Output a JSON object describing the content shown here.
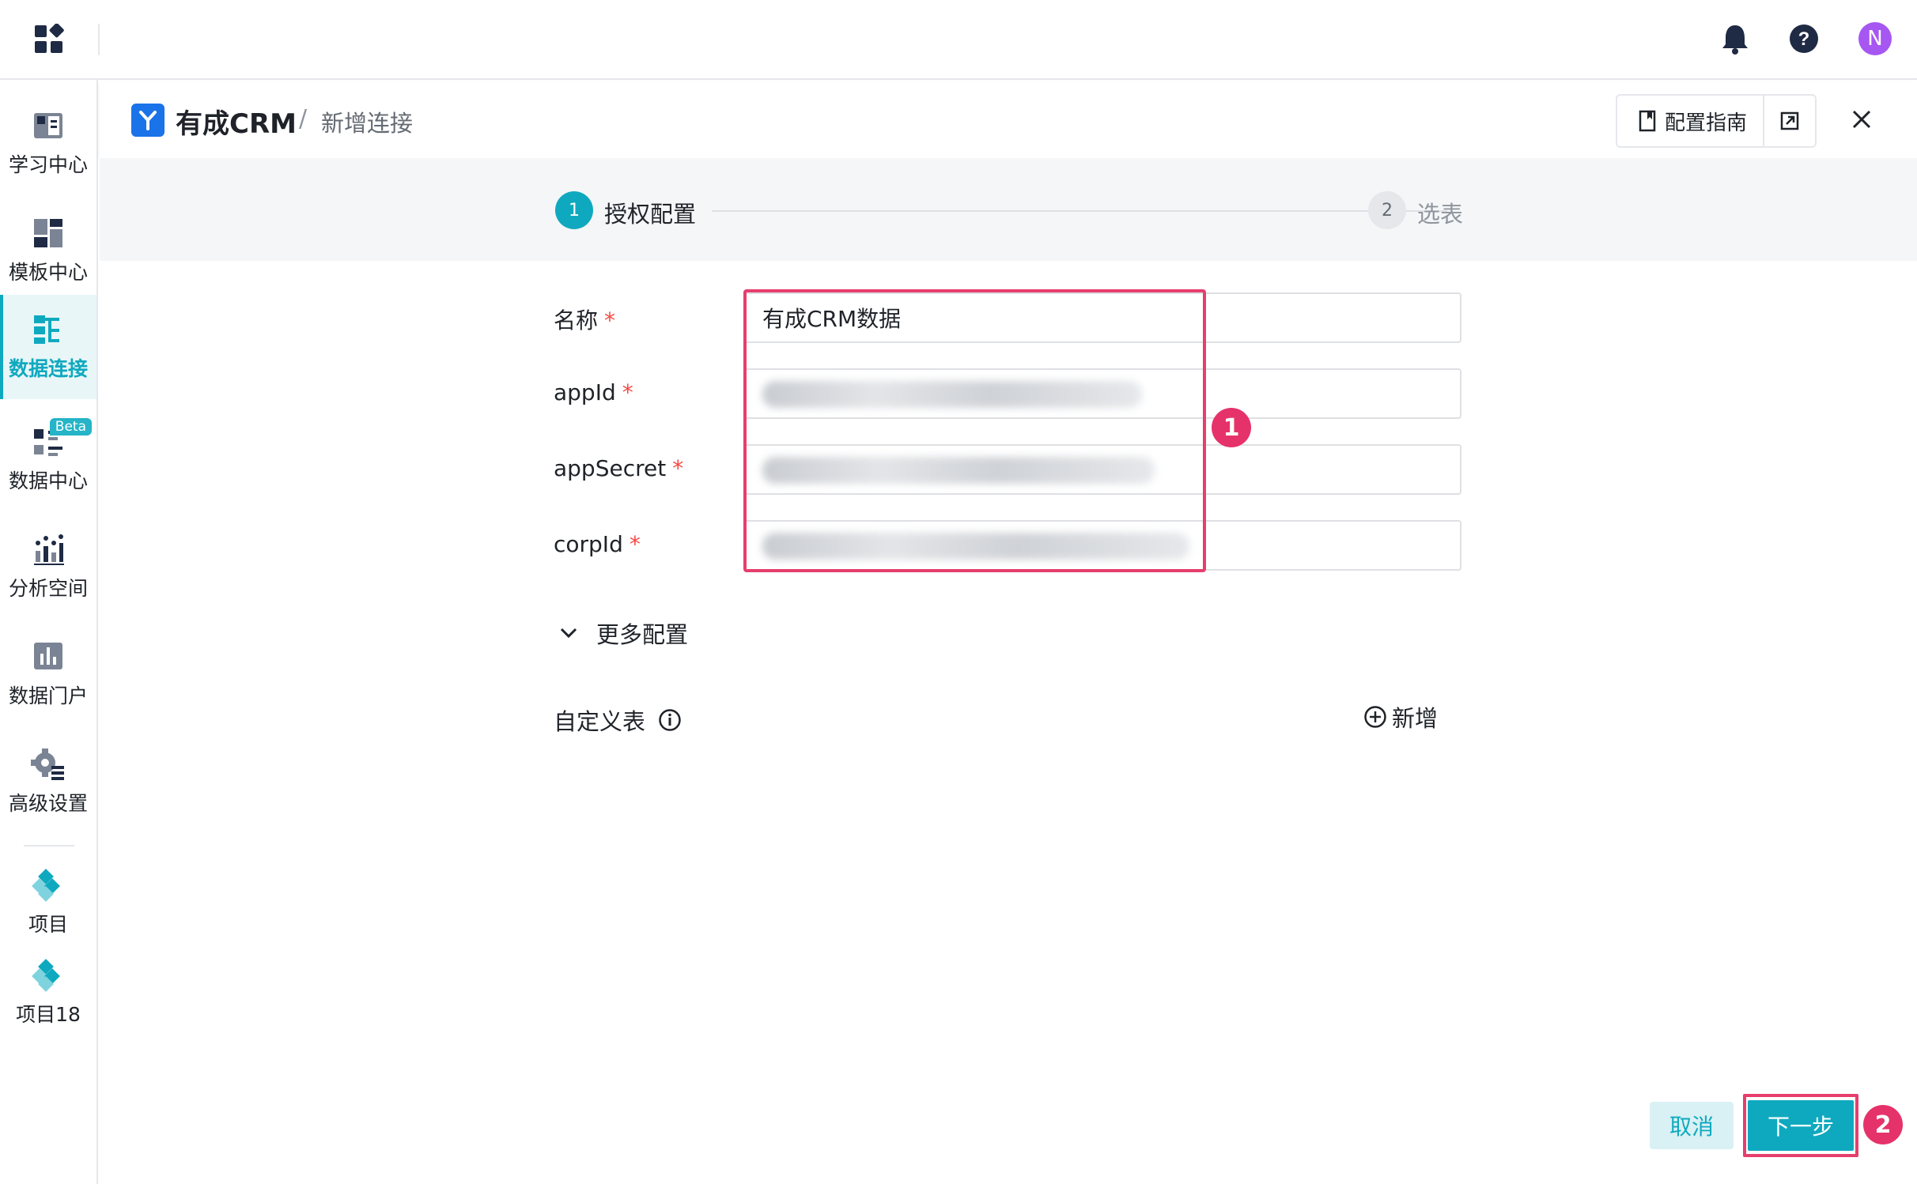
{
  "topbar": {
    "avatar_letter": "N",
    "icons": [
      "apps-grid-icon",
      "bell-icon",
      "help-icon"
    ]
  },
  "sidebar": {
    "items": [
      {
        "label": "学习中心",
        "icon": "book-icon"
      },
      {
        "label": "模板中心",
        "icon": "template-icon"
      },
      {
        "label": "数据连接",
        "icon": "data-connect-icon",
        "active": true
      },
      {
        "label": "数据中心",
        "icon": "data-center-icon",
        "badge": "Beta"
      },
      {
        "label": "分析空间",
        "icon": "analysis-icon"
      },
      {
        "label": "数据门户",
        "icon": "portal-icon"
      },
      {
        "label": "高级设置",
        "icon": "gear-icon"
      }
    ],
    "projects": [
      {
        "label": "项目",
        "icon": "project-icon"
      },
      {
        "label": "项目18",
        "icon": "project-icon"
      }
    ]
  },
  "header": {
    "brand": "有成CRM",
    "breadcrumb_sep": "/",
    "breadcrumb_current": "新增连接",
    "guide_label": "配置指南"
  },
  "steps": [
    {
      "number": "1",
      "label": "授权配置",
      "active": true
    },
    {
      "number": "2",
      "label": "选表",
      "active": false
    }
  ],
  "form": {
    "required_mark": "*",
    "fields": [
      {
        "label": "名称",
        "value": "有成CRM数据"
      },
      {
        "label": "appId",
        "value": ""
      },
      {
        "label": "appSecret",
        "value": ""
      },
      {
        "label": "corpId",
        "value": ""
      }
    ],
    "more_config": "更多配置",
    "custom_table_label": "自定义表",
    "add_label": "新增"
  },
  "footer": {
    "cancel_label": "取消",
    "next_label": "下一步"
  },
  "annotations": {
    "badge1": "1",
    "badge2": "2"
  },
  "colors": {
    "accent": "#0fa9bf",
    "highlight": "#e63e6d",
    "avatar": "#a657f2",
    "brand_logo": "#1a73e8"
  }
}
